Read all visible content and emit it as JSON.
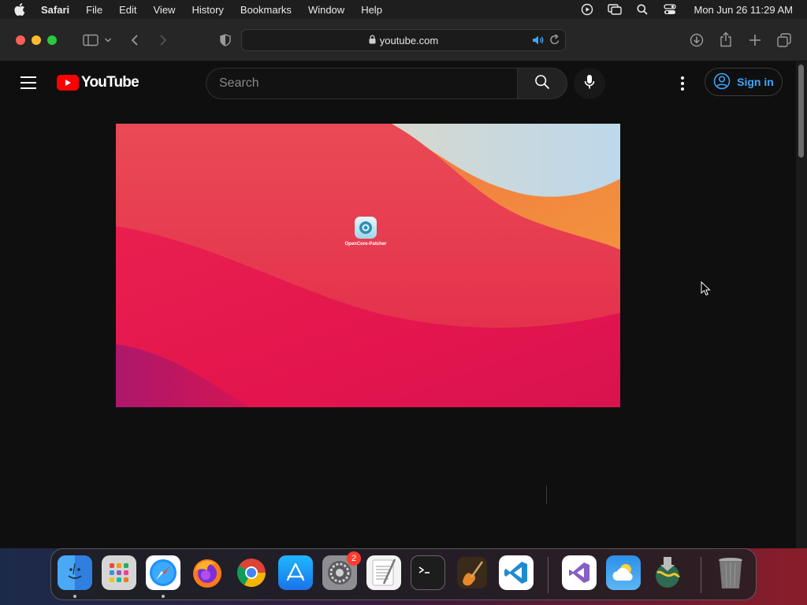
{
  "menubar": {
    "app_name": "Safari",
    "items": [
      "File",
      "Edit",
      "View",
      "History",
      "Bookmarks",
      "Window",
      "Help"
    ],
    "clock": "Mon Jun 26  11:29 AM",
    "status_icons": [
      "screen-record-icon",
      "screen-mirroring-icon",
      "spotlight-search-icon",
      "control-center-icon"
    ]
  },
  "browser": {
    "url": "youtube.com",
    "toolbar_icons": [
      "sidebar-icon",
      "chevron-down-icon",
      "back-icon",
      "forward-icon",
      "privacy-shield-icon",
      "downloads-icon",
      "share-icon",
      "new-tab-icon",
      "tab-overview-icon"
    ]
  },
  "youtube": {
    "logo_text": "YouTube",
    "search_placeholder": "Search",
    "signin_label": "Sign in",
    "video": {
      "desktop_icon_label": "OpenCore-Patcher"
    }
  },
  "dock": {
    "items": [
      {
        "name": "Finder",
        "running": true
      },
      {
        "name": "Launchpad",
        "running": false
      },
      {
        "name": "Safari",
        "running": true
      },
      {
        "name": "Firefox",
        "running": false
      },
      {
        "name": "Google Chrome",
        "running": false
      },
      {
        "name": "App Store",
        "running": false
      },
      {
        "name": "System Settings",
        "running": false,
        "badge": "2"
      },
      {
        "name": "TextEdit",
        "running": false
      },
      {
        "name": "Terminal",
        "running": false
      },
      {
        "name": "GarageBand",
        "running": false
      },
      {
        "name": "Visual Studio Code",
        "running": false
      },
      {
        "name": "Visual Studio",
        "running": false
      },
      {
        "name": "Weather",
        "running": false
      },
      {
        "name": "Downloads",
        "running": false
      },
      {
        "name": "Trash",
        "running": false
      }
    ]
  },
  "colors": {
    "youtube_red": "#ff0000",
    "link_blue": "#3ea6ff",
    "page_bg": "#0f0f0f"
  }
}
